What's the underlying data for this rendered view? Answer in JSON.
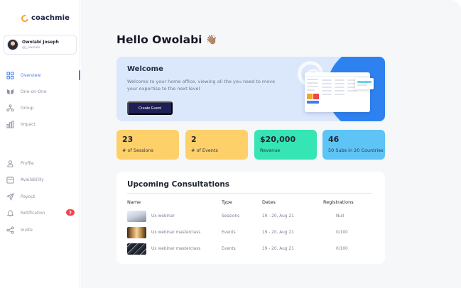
{
  "brand": {
    "name": "coachmie",
    "color": "#f5a524"
  },
  "user": {
    "name": "Owolabi Joseph",
    "handle": "@J_owolabi"
  },
  "nav": {
    "main": [
      {
        "label": "Overview",
        "icon": "grid-icon",
        "active": true
      },
      {
        "label": "One-on-One",
        "icon": "one-on-one-icon",
        "active": false
      },
      {
        "label": "Group",
        "icon": "group-icon",
        "active": false
      },
      {
        "label": "Impact",
        "icon": "impact-icon",
        "active": false
      }
    ],
    "secondary": [
      {
        "label": "Profile",
        "icon": "profile-icon"
      },
      {
        "label": "Availability",
        "icon": "calendar-icon"
      },
      {
        "label": "Payout",
        "icon": "send-icon"
      },
      {
        "label": "Notification",
        "icon": "bell-icon",
        "badge": "3"
      },
      {
        "label": "Invite",
        "icon": "share-icon"
      }
    ]
  },
  "greeting": {
    "text": "Hello Owolabi",
    "emoji": "👋🏽"
  },
  "welcome": {
    "title": "Welcome",
    "text": "Welcome to your home office, viewing all the you need to move your expertise to the next level",
    "button": "Create Event"
  },
  "stats": [
    {
      "value": "23",
      "label": "# of Sessions",
      "color": "#fdd069"
    },
    {
      "value": "2",
      "label": "# of Events",
      "color": "#fdd069"
    },
    {
      "value": "$20,000",
      "label": "Revenue",
      "color": "#35e5b4"
    },
    {
      "value": "46",
      "label": "50 Subs in 20 Countries",
      "color": "#5ec4f5"
    }
  ],
  "consultations": {
    "title": "Upcoming Consultations",
    "columns": [
      "Name",
      "Type",
      "Dates",
      "Registrations"
    ],
    "rows": [
      {
        "name": "Ux webinar",
        "type": "Sessions",
        "dates": "19 - 20, Aug 21",
        "registrations": "Null"
      },
      {
        "name": "Ux webinar masterclass",
        "type": "Events",
        "dates": "19 - 20, Aug 21",
        "registrations": "0/100"
      },
      {
        "name": "Ux webinar masterclass",
        "type": "Events",
        "dates": "19 - 20, Aug 21",
        "registrations": "0/100"
      }
    ]
  }
}
